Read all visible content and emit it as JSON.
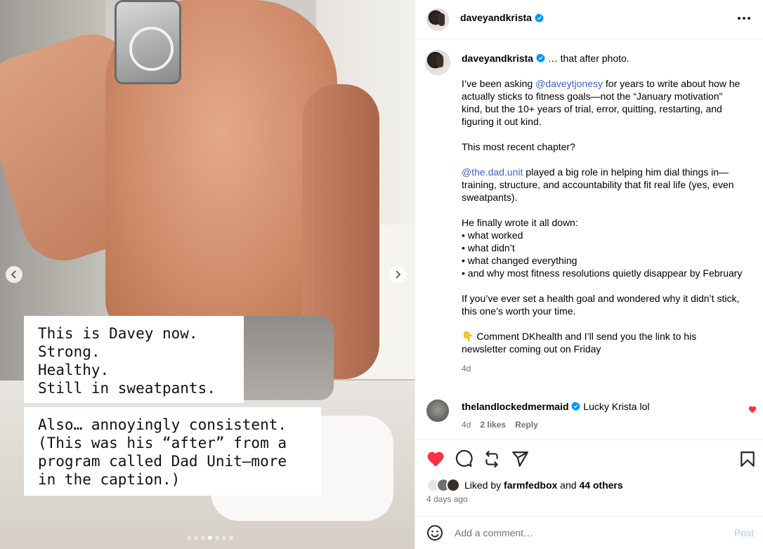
{
  "post": {
    "username": "daveyandkrista",
    "more_label": "More options"
  },
  "media": {
    "caption_box_1": "This is Davey now.\nStrong.\nHealthy.\nStill in sweatpants.",
    "caption_box_2": "Also… annoyingly consistent.\n(This was his “after” from a\nprogram called Dad Unit—more\nin the caption.)",
    "carousel": {
      "total": 7,
      "active_index": 3
    }
  },
  "caption": {
    "username": "daveyandkrista",
    "intro": " … that after photo.",
    "p1_pre": "I’ve been asking ",
    "p1_mention": "@daveytjonesy",
    "p1_post": " for years to write about how he actually sticks to fitness goals—not the “January motivation” kind, but the 10+ years of trial, error, quitting, restarting, and figuring it out kind.",
    "p2": "This most recent chapter?",
    "p3_mention": "@the.dad.unit",
    "p3_post": " played a big role in helping him dial things in—training, structure, and accountability that fit real life (yes, even sweatpants).",
    "p4_line1": "He finally wrote it all down:",
    "p4_line2": "• what worked",
    "p4_line3": "• what didn’t",
    "p4_line4": "• what changed everything",
    "p4_line5": "• and why most fitness resolutions quietly disappear by February",
    "p5": "If you’ve ever set a health goal and wondered why it didn’t stick, this one’s worth your time.",
    "p6": "👇 Comment DKhealth and I’ll send you the link to his newsletter coming out on Friday",
    "time": "4d"
  },
  "comment": {
    "username": "thelandlockedmermaid",
    "text": "Lucky Krista lol",
    "time": "4d",
    "likes": "2 likes",
    "reply": "Reply"
  },
  "likes": {
    "prefix": "Liked by ",
    "liker": "farmfedbox",
    "and": " and ",
    "others": "44 others"
  },
  "posted_ago": "4 days ago",
  "add_comment": {
    "placeholder": "Add a comment…",
    "post_label": "Post"
  },
  "colors": {
    "like_red": "#ff3040",
    "mention_blue": "#3f63c4",
    "verified_blue": "#0095f6",
    "muted": "#737373"
  }
}
